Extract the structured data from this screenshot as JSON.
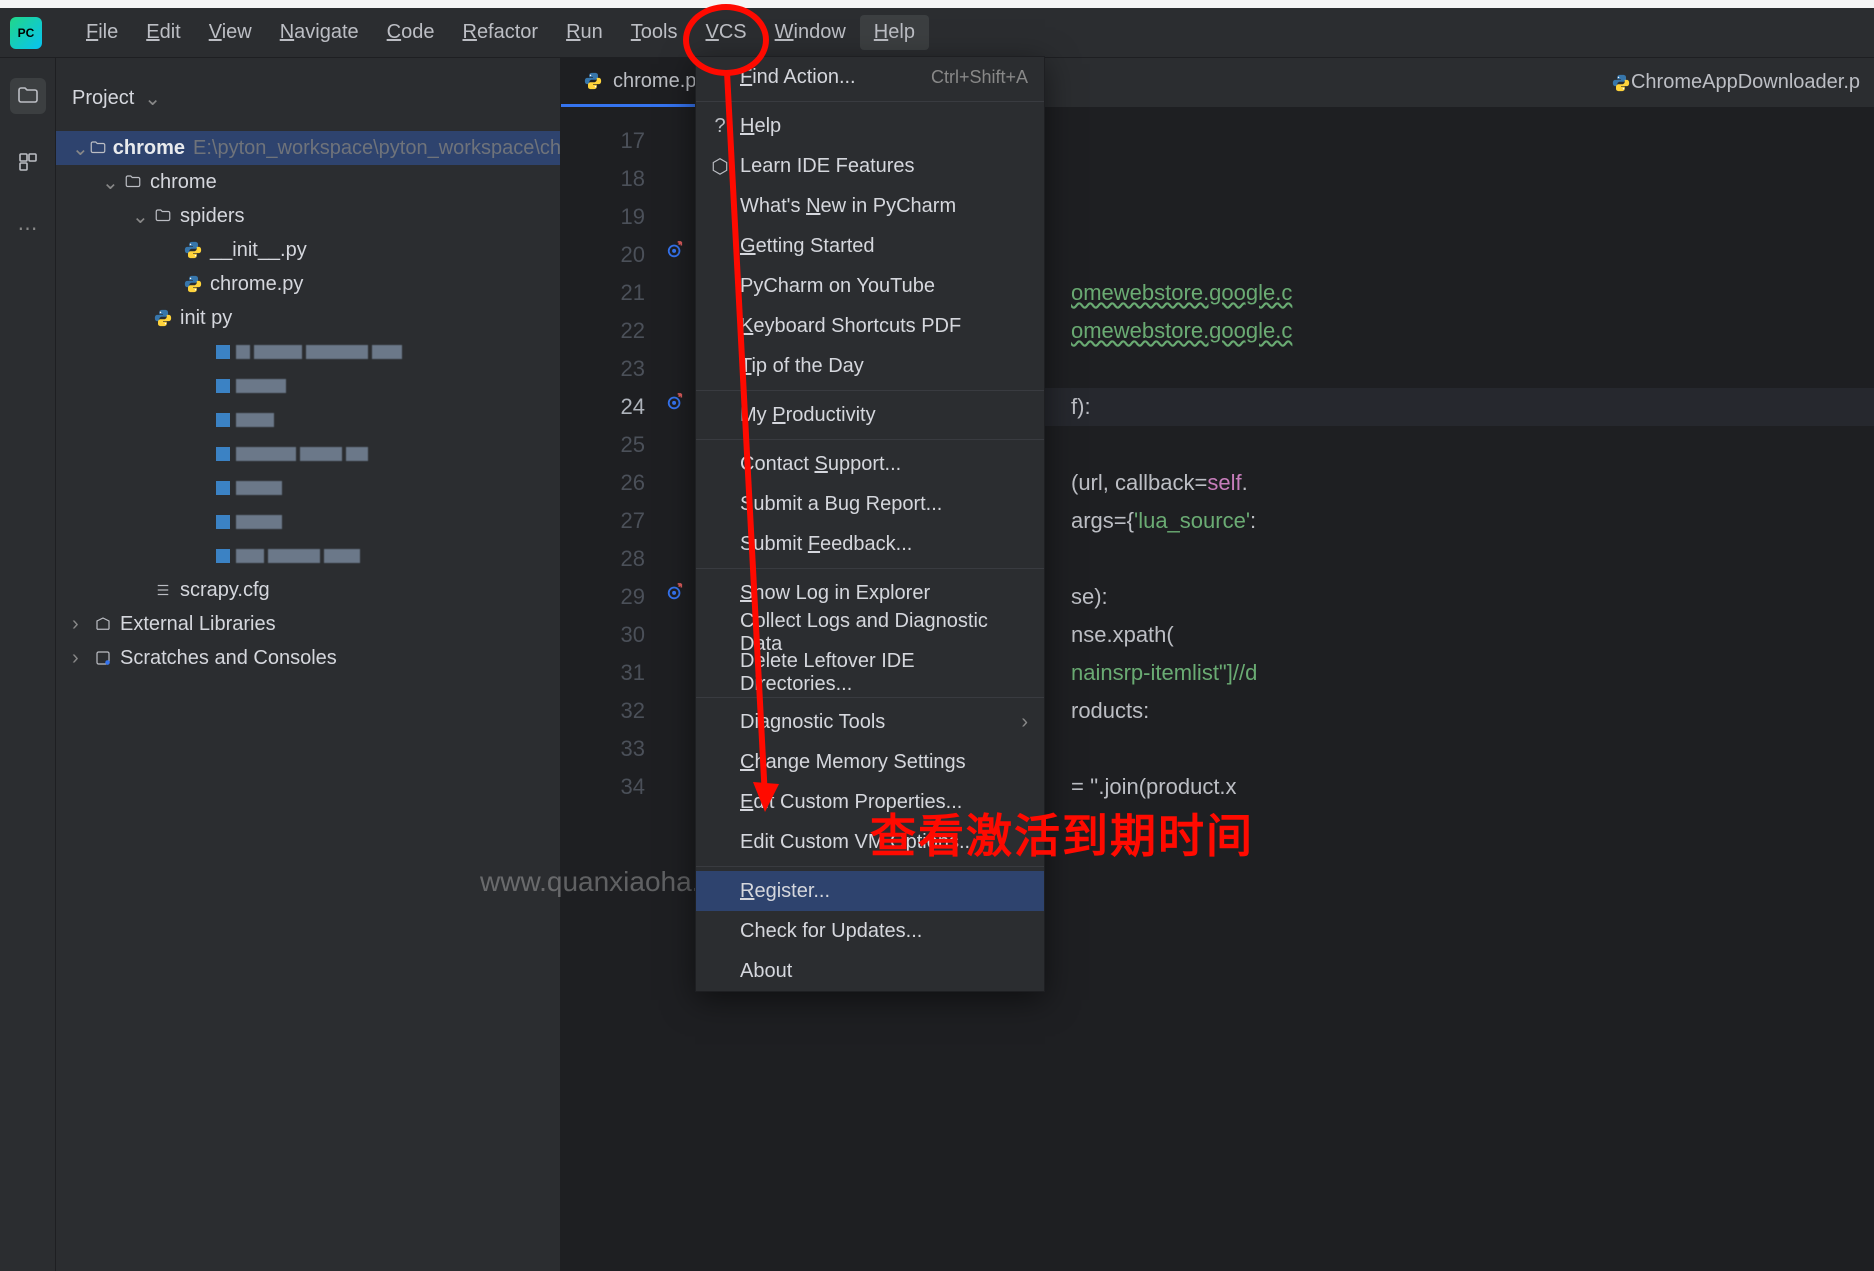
{
  "menubar": {
    "items": [
      "File",
      "Edit",
      "View",
      "Navigate",
      "Code",
      "Refactor",
      "Run",
      "Tools",
      "VCS",
      "Window",
      "Help"
    ],
    "active_index": 10
  },
  "project_panel": {
    "title": "Project",
    "tree": {
      "root": {
        "name": "chrome",
        "path": "E:\\pyton_workspace\\pyton_workspace\\chrome"
      },
      "children": [
        {
          "name": "chrome",
          "kind": "folder",
          "depth": 1,
          "expanded": true
        },
        {
          "name": "spiders",
          "kind": "folder",
          "depth": 2,
          "expanded": true
        },
        {
          "name": "__init__.py",
          "kind": "py",
          "depth": 3
        },
        {
          "name": "chrome.py",
          "kind": "py",
          "depth": 3
        },
        {
          "name": "init   py",
          "kind": "py",
          "depth": 2
        }
      ],
      "extra": [
        {
          "name": "scrapy.cfg",
          "kind": "file",
          "depth": 2
        },
        {
          "name": "External Libraries",
          "kind": "lib",
          "depth": 0
        },
        {
          "name": "Scratches and Consoles",
          "kind": "scratch",
          "depth": 0
        }
      ]
    }
  },
  "tabs": {
    "left": "chrome.py",
    "right": "ChromeAppDownloader.p"
  },
  "gutter": {
    "start": 17,
    "end": 34,
    "current": 24,
    "override_markers": [
      20,
      24,
      29
    ]
  },
  "code_lines": {
    "21": "omewebstore.google.c",
    "22": "omewebstore.google.c",
    "24": "f):",
    "26_a": "(url, ",
    "26_b": "callback",
    "26_c": "=",
    "26_d": "self",
    "26_e": ".",
    "27_a": "args",
    "27_b": "={",
    "27_c": "'lua_source'",
    "27_d": ":",
    "29": "se):",
    "30": "nse.xpath(",
    "31": "nainsrp-itemlist\"]//d",
    "32": "roducts:",
    "34": "= ''.join(product.x"
  },
  "help_menu": {
    "items": [
      {
        "label": "Find Action...",
        "u": "F",
        "shortcut": "Ctrl+Shift+A"
      },
      {
        "sep": true
      },
      {
        "label": "Help",
        "u": "H",
        "icon": "?"
      },
      {
        "label": "Learn IDE Features",
        "icon": "cap"
      },
      {
        "label": "What's New in PyCharm",
        "u": "N"
      },
      {
        "label": "Getting Started",
        "u": "G"
      },
      {
        "label": "PyCharm on YouTube"
      },
      {
        "label": "Keyboard Shortcuts PDF",
        "u": "K"
      },
      {
        "label": "Tip of the Day",
        "u": "T"
      },
      {
        "sep": true
      },
      {
        "label": "My Productivity",
        "u": "P"
      },
      {
        "sep": true
      },
      {
        "label": "Contact Support...",
        "u": "S"
      },
      {
        "label": "Submit a Bug Report..."
      },
      {
        "label": "Submit Feedback...",
        "u": "F"
      },
      {
        "sep": true
      },
      {
        "label": "Show Log in Explorer",
        "u": "S"
      },
      {
        "label": "Collect Logs and Diagnostic Data"
      },
      {
        "label": "Delete Leftover IDE Directories..."
      },
      {
        "sep": true
      },
      {
        "label": "Diagnostic Tools",
        "submenu": true
      },
      {
        "label": "Change Memory Settings",
        "u": "C"
      },
      {
        "label": "Edit Custom Properties...",
        "u": "E"
      },
      {
        "label": "Edit Custom VM Options..."
      },
      {
        "sep": true
      },
      {
        "label": "Register...",
        "u": "R",
        "highlight": true
      },
      {
        "label": "Check for Updates..."
      },
      {
        "label": "About"
      }
    ]
  },
  "annotations": {
    "text": "查看激活到期时间",
    "watermark": "www.quanxiaoha.com 犬小哈教程"
  }
}
